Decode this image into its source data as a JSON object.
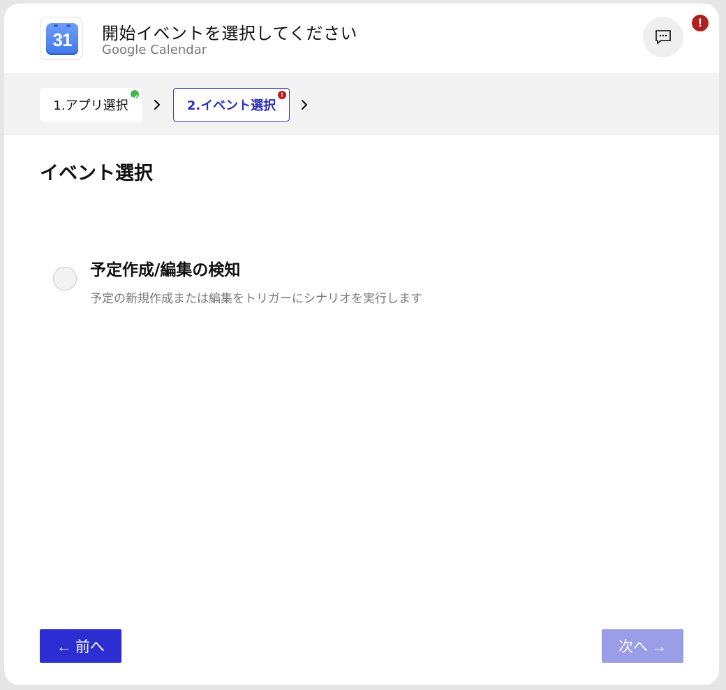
{
  "header": {
    "app_logo_text": "31",
    "title": "開始イベントを選択してください",
    "subtitle": "Google Calendar",
    "alert_badge": "!"
  },
  "stepper": {
    "steps": [
      {
        "label": "1.アプリ選択",
        "status": "complete"
      },
      {
        "label": "2.イベント選択",
        "status": "error",
        "badge": "!"
      }
    ]
  },
  "main": {
    "section_title": "イベント選択",
    "options": [
      {
        "title": "予定作成/編集の検知",
        "description": "予定の新規作成または編集をトリガーにシナリオを実行します",
        "selected": false
      }
    ]
  },
  "footer": {
    "prev_label": "← 前へ",
    "next_label": "次へ →"
  },
  "colors": {
    "primary": "#2c2ed2",
    "primary_disabled": "#9a9ee6",
    "success": "#3dbb4a",
    "error": "#b21f1f"
  }
}
